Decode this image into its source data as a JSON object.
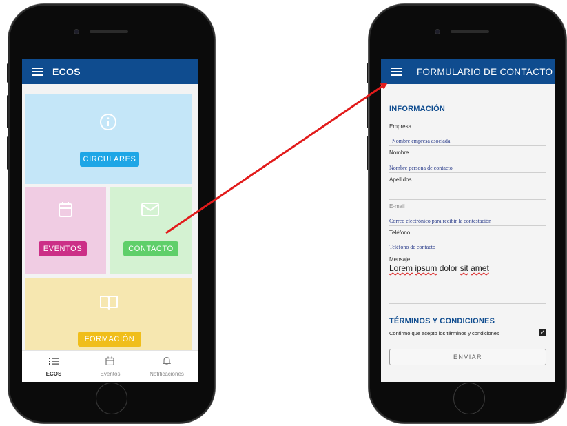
{
  "left": {
    "app_title": "ECOS",
    "tiles": {
      "circulares": "CIRCULARES",
      "eventos": "EVENTOS",
      "contacto": "CONTACTO",
      "formacion": "FORMACIÓN"
    },
    "tabs": [
      {
        "label": "ECOS",
        "icon": "list-icon"
      },
      {
        "label": "Eventos",
        "icon": "calendar-icon"
      },
      {
        "label": "Notificaciones",
        "icon": "bell-icon"
      }
    ],
    "colors": {
      "appbar": "#0f4c8f",
      "circulares_bg": "#c4e6f8",
      "circulares_btn": "#1ea6e6",
      "eventos_bg": "#f0cce3",
      "eventos_btn": "#cc2f87",
      "contacto_bg": "#d4f2d2",
      "contacto_btn": "#5fcf6a",
      "formacion_bg": "#f6e7b0",
      "formacion_btn": "#f0be1a"
    }
  },
  "right": {
    "app_title": "FORMULARIO DE CONTACTO",
    "section_info": "INFORMACIÓN",
    "fields": {
      "empresa_label": "Empresa",
      "empresa_value": "Nombre empresa asociada",
      "nombre_label": "Nombre",
      "nombre_value": "Nombre persona de contacto",
      "apellidos_label": "Apellidos",
      "email_label": "E-mail",
      "email_value": "Correo electrónico para recibir la contestación",
      "telefono_label": "Teléfono",
      "telefono_value": "Teléfono de contacto",
      "mensaje_label": "Mensaje",
      "mensaje_w1": "Lorem",
      "mensaje_w2": "ipsum",
      "mensaje_w3": "dolor",
      "mensaje_w4": "sit",
      "mensaje_w5": "amet"
    },
    "section_terms": "TÉRMINOS Y CONDICIONES",
    "terms_text": "Confirmo que acepto los términos y condiciones",
    "terms_checked": true,
    "submit_label": "ENVIAR"
  },
  "arrow_color": "#e21b1b"
}
